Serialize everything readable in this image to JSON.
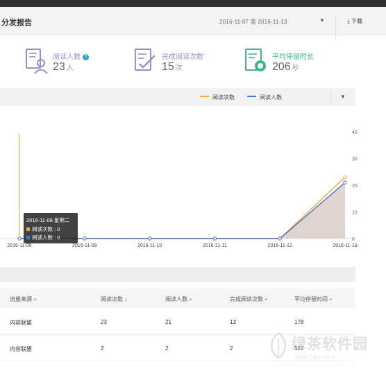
{
  "header": {
    "title": "分发报告",
    "date_range": "2016-11-07 至 2016-11-13",
    "download_label": "下载"
  },
  "kpis": [
    {
      "label": "阅读人数",
      "value": "23",
      "unit": "人",
      "icon": "reader-person-icon",
      "color": "#9b8ec7"
    },
    {
      "label": "完成阅读次数",
      "value": "15",
      "unit": "次",
      "icon": "checklist-icon",
      "color": "#9b8ec7"
    },
    {
      "label": "平均停留时长",
      "value": "206",
      "unit": "秒",
      "icon": "clock-document-icon",
      "color": "#3bb58f"
    }
  ],
  "legend": {
    "series1": "阅读次数",
    "series2": "阅读人数"
  },
  "chart_data": {
    "type": "line",
    "categories": [
      "2016-11-08",
      "2016-11-09",
      "2016-11-10",
      "2016-11-11",
      "2016-11-12",
      "2016-11-13"
    ],
    "x_tick_labels": [
      "2016-11-08",
      "2016-11-09",
      "2016-11-10",
      "2016-11-11",
      "2016-11-12",
      "2016-11-13"
    ],
    "y_ticks": [
      0,
      10,
      20,
      30,
      40
    ],
    "ylim": [
      0,
      40
    ],
    "series": [
      {
        "name": "阅读次数",
        "color": "#f0a746",
        "values": [
          0,
          0,
          0,
          0,
          0,
          23
        ]
      },
      {
        "name": "阅读人数",
        "color": "#4a6fc7",
        "values": [
          0,
          0,
          0,
          0,
          0,
          21
        ]
      }
    ]
  },
  "tooltip": {
    "title": "2016-11-08 星期二",
    "row1": "阅读次数 : 0",
    "row2": "阅读人数 : 0"
  },
  "table": {
    "headers": [
      "流量来源",
      "阅读次数",
      "阅读人数",
      "完成阅读次数",
      "平均停留时间"
    ],
    "rows": [
      [
        "内容联盟",
        "23",
        "21",
        "13",
        "178"
      ],
      [
        "内容联盟",
        "2",
        "2",
        "2",
        "522"
      ]
    ]
  },
  "watermark": {
    "text": "绿茶软件园",
    "url": "www.33lc.com"
  }
}
